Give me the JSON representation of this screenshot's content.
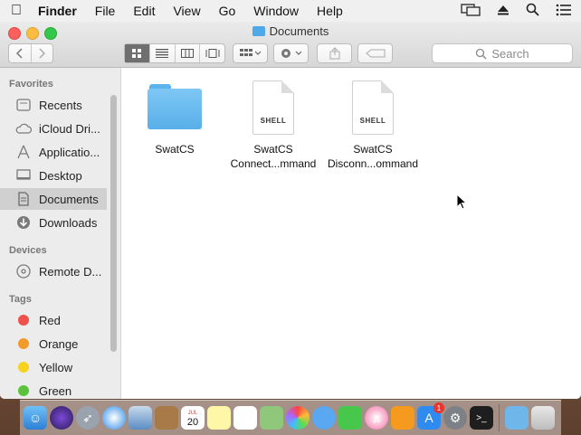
{
  "menubar": {
    "apple": "",
    "items": [
      "Finder",
      "File",
      "Edit",
      "View",
      "Go",
      "Window",
      "Help"
    ]
  },
  "window": {
    "title": "Documents",
    "search_placeholder": "Search"
  },
  "sidebar": {
    "favorites_label": "Favorites",
    "favorites": [
      {
        "label": "Recents",
        "icon": "clock-icon"
      },
      {
        "label": "iCloud Dri...",
        "icon": "cloud-icon"
      },
      {
        "label": "Applicatio...",
        "icon": "applications-icon"
      },
      {
        "label": "Desktop",
        "icon": "desktop-icon"
      },
      {
        "label": "Documents",
        "icon": "documents-icon",
        "selected": true
      },
      {
        "label": "Downloads",
        "icon": "download-icon"
      }
    ],
    "devices_label": "Devices",
    "devices": [
      {
        "label": "Remote D...",
        "icon": "disc-icon"
      }
    ],
    "tags_label": "Tags",
    "tags": [
      {
        "label": "Red",
        "color": "#f0504b"
      },
      {
        "label": "Orange",
        "color": "#f39a2b"
      },
      {
        "label": "Yellow",
        "color": "#f5d31f"
      },
      {
        "label": "Green",
        "color": "#5ac33e"
      }
    ]
  },
  "files": [
    {
      "name": "SwatCS",
      "type": "folder"
    },
    {
      "name": "SwatCS",
      "name2": "Connect...mmand",
      "type": "shell",
      "tag": "SHELL"
    },
    {
      "name": "SwatCS",
      "name2": "Disconn...ommand",
      "type": "shell",
      "tag": "SHELL"
    }
  ],
  "dock": {
    "calendar_day": "20",
    "calendar_month": "JUL",
    "appstore_badge": "1"
  }
}
